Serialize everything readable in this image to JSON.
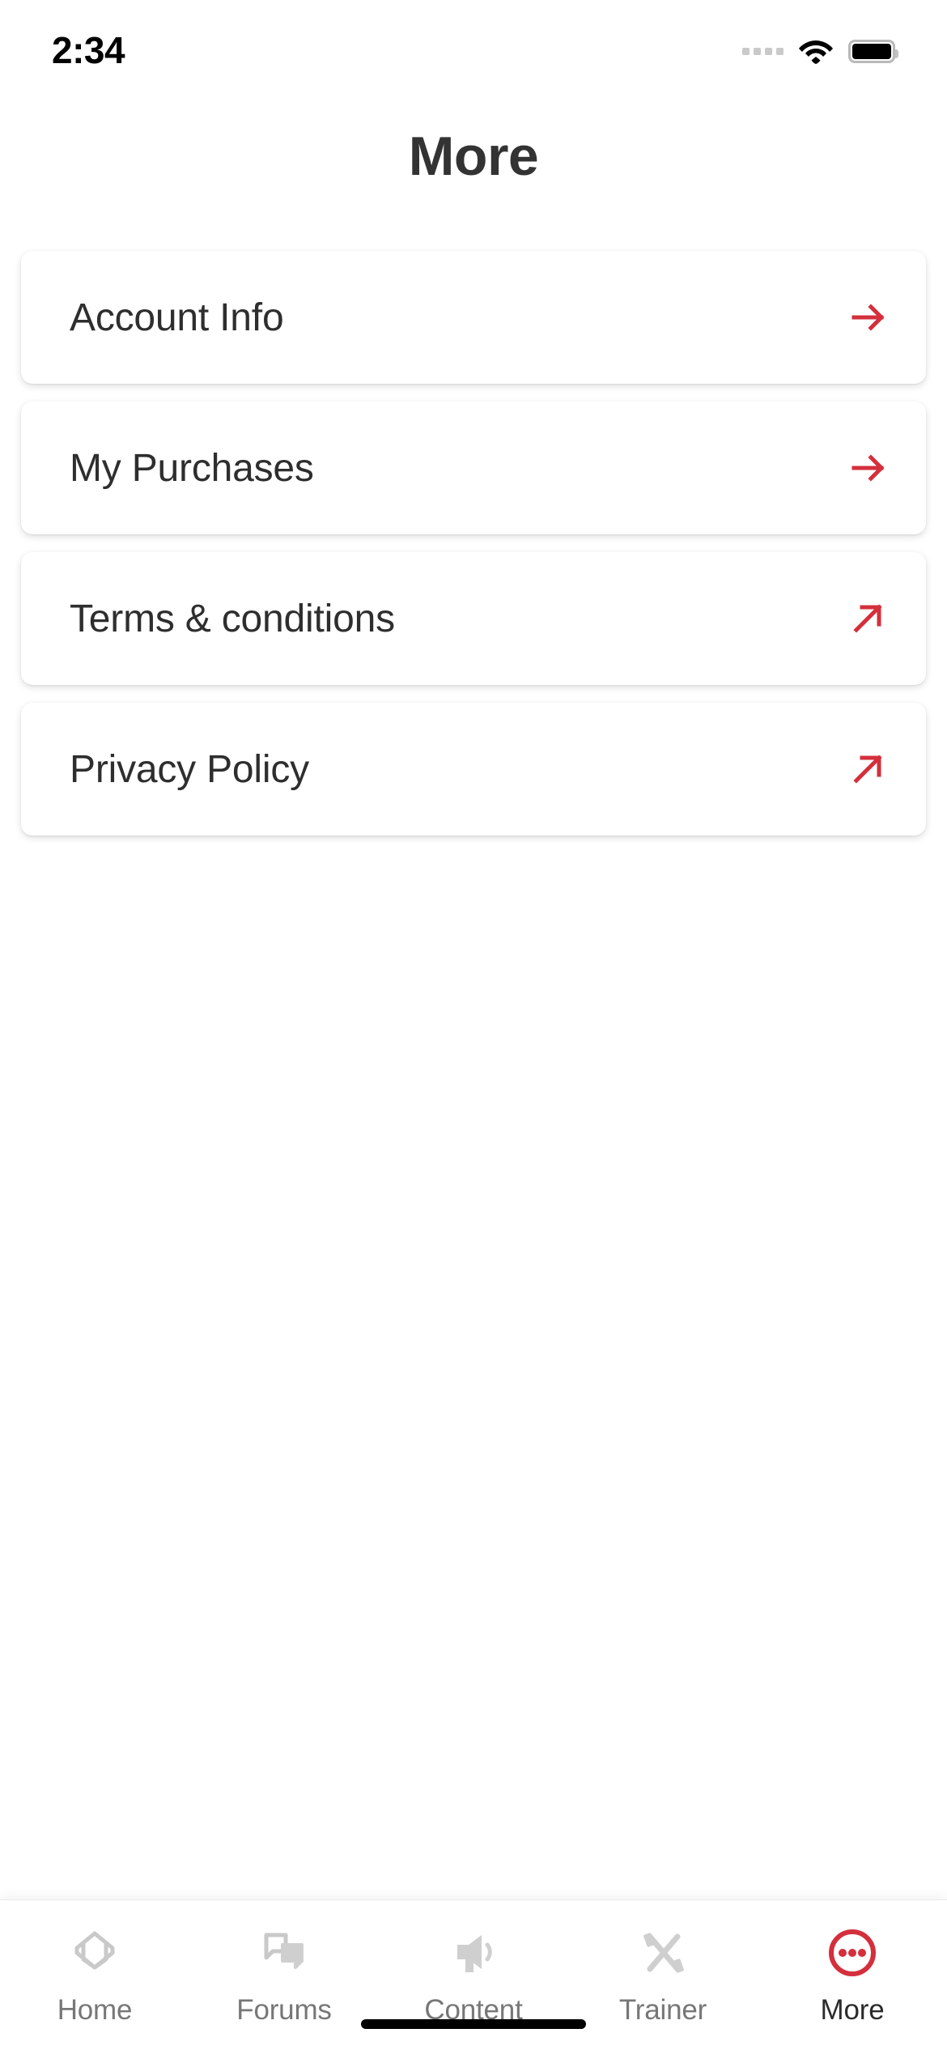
{
  "status_bar": {
    "time": "2:34",
    "signal_icon": "signal-dots-icon",
    "wifi_icon": "wifi-icon",
    "battery_icon": "battery-full-icon"
  },
  "header": {
    "title": "More"
  },
  "theme": {
    "accent_red": "#D42F3C",
    "title_color": "#333333",
    "label_color": "#2E2E2E",
    "tab_inactive_color": "#777777",
    "tab_active_color": "#2B2B2B",
    "card_background": "#FFFFFF",
    "page_background": "#FFFFFF"
  },
  "main": {
    "cards": [
      {
        "label": "Account Info",
        "arrow_icon": "arrow-right-icon",
        "arrow_type": "right"
      },
      {
        "label": "My Purchases",
        "arrow_icon": "arrow-right-icon",
        "arrow_type": "right"
      },
      {
        "label": "Terms & conditions",
        "arrow_icon": "arrow-up-right-icon",
        "arrow_type": "diagonal"
      },
      {
        "label": "Privacy Policy",
        "arrow_icon": "arrow-up-right-icon",
        "arrow_type": "diagonal"
      }
    ]
  },
  "tabbar": {
    "items": [
      {
        "label": "Home",
        "icon": "graduation-cap-icon",
        "active": false
      },
      {
        "label": "Forums",
        "icon": "chat-bubbles-icon",
        "active": false
      },
      {
        "label": "Content",
        "icon": "megaphone-icon",
        "active": false
      },
      {
        "label": "Trainer",
        "icon": "dumbbell-icon",
        "active": false
      },
      {
        "label": "More",
        "icon": "more-circle-icon",
        "active": true
      }
    ]
  }
}
